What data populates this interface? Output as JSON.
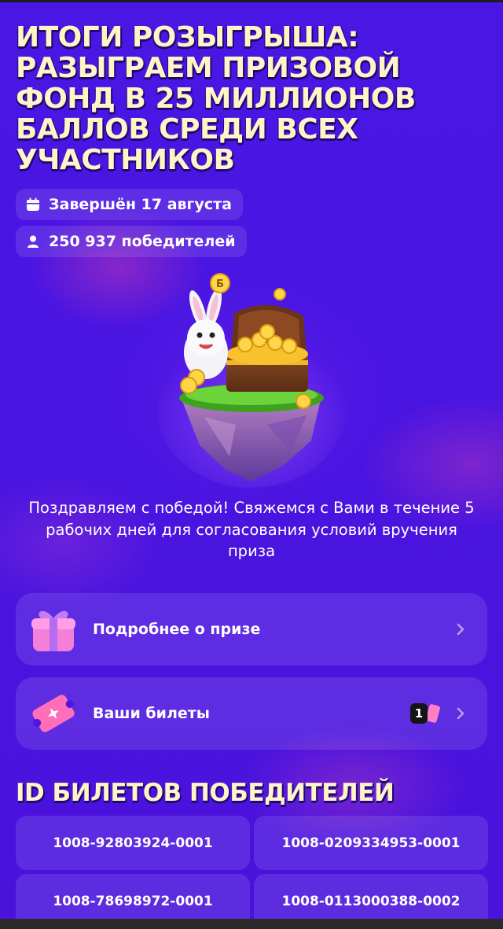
{
  "page": {
    "title": "ИТОГИ РОЗЫГРЫША: РАЗЫГРАЕМ ПРИЗОВОЙ ФОНД В 25 МИЛЛИОНОВ БАЛЛОВ СРЕДИ ВСЕХ УЧАСТНИКОВ"
  },
  "meta": {
    "end_date": "Завершён 17 августа",
    "winners": "250 937 победителей",
    "date_icon": "calendar-icon",
    "winners_icon": "user-icon"
  },
  "hero": {
    "icon": "bunny-treasure-chest-illustration",
    "coin_letter": "Б"
  },
  "congrats_text": "Поздравляем с победой! Свяжемся с Вами в течение 5 рабочих дней для согласования условий вручения приза",
  "menu": {
    "prize_label": "Подробнее о призе",
    "tickets_label": "Ваши билеты",
    "tickets_count": "1"
  },
  "winners_section": {
    "title": "ID БИЛЕТОВ ПОБЕДИТЕЛЕЙ",
    "ids": [
      "1008-92803924-0001",
      "1008-0209334953-0001",
      "1008-78698972-0001",
      "1008-0113000388-0002"
    ]
  },
  "colors": {
    "background": "#4a14e0",
    "title": "#fff3c8",
    "card": "rgba(255,255,255,0.11)"
  }
}
